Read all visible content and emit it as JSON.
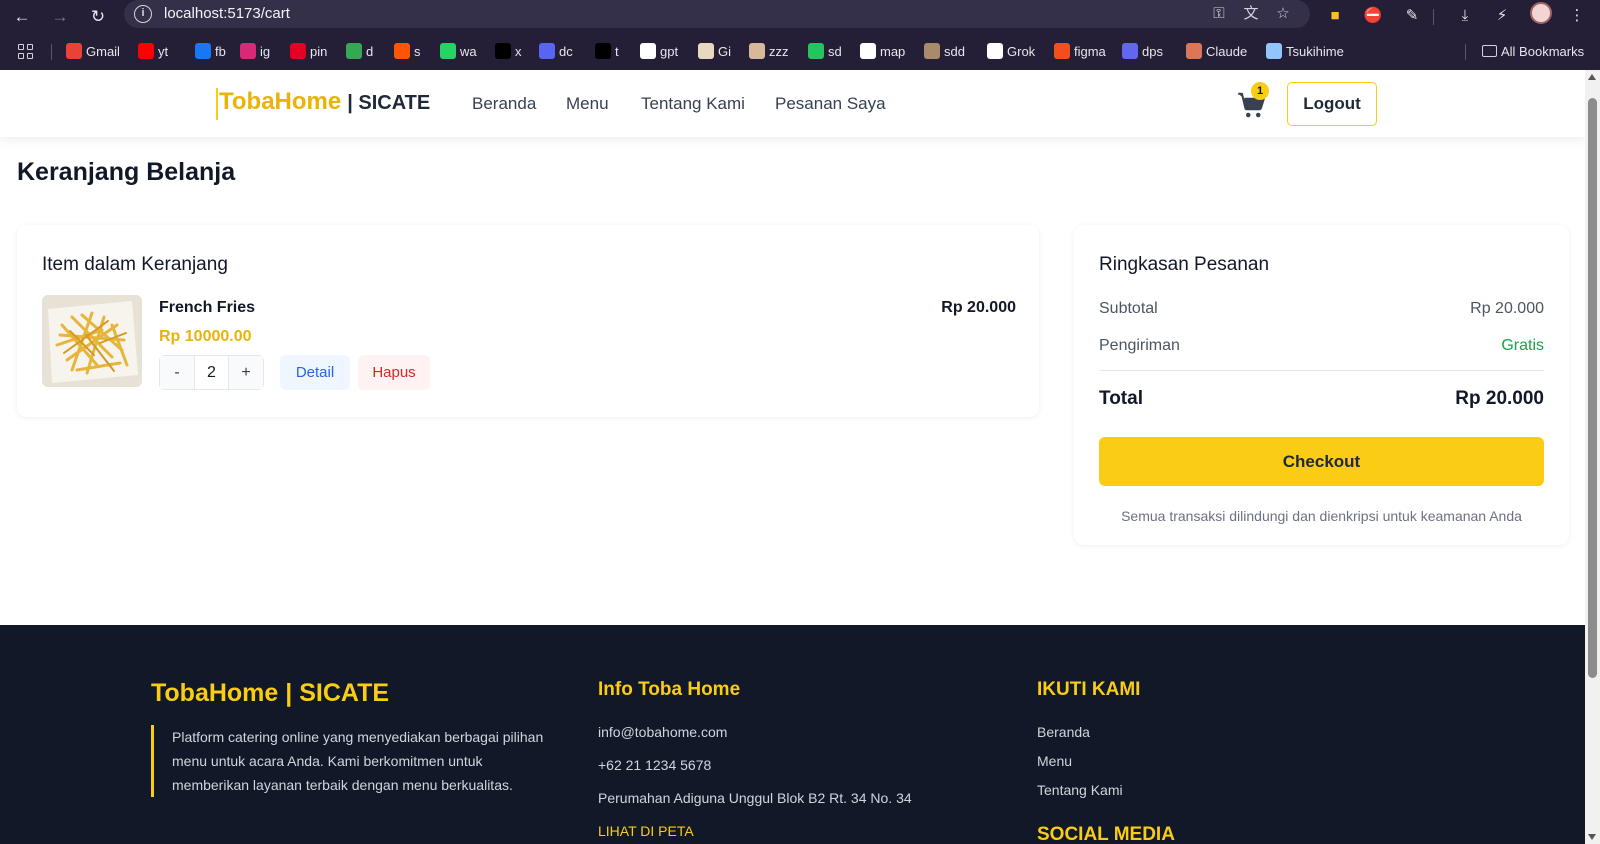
{
  "browser": {
    "url": "localhost:5173/cart",
    "bookmarks": [
      {
        "label": "Gmail",
        "color": "#ea4335"
      },
      {
        "label": "yt",
        "color": "#ff0000"
      },
      {
        "label": "fb",
        "color": "#1877f2"
      },
      {
        "label": "ig",
        "color": "#d62976"
      },
      {
        "label": "pin",
        "color": "#e60023"
      },
      {
        "label": "d",
        "color": "#34a853"
      },
      {
        "label": "s",
        "color": "#ff5500"
      },
      {
        "label": "wa",
        "color": "#25d366"
      },
      {
        "label": "x",
        "color": "#000000"
      },
      {
        "label": "dc",
        "color": "#5865f2"
      },
      {
        "label": "t",
        "color": "#000000"
      },
      {
        "label": "gpt",
        "color": "#ffffff"
      },
      {
        "label": "Gi",
        "color": "#e8d8c0"
      },
      {
        "label": "zzz",
        "color": "#d9b99b"
      },
      {
        "label": "sd",
        "color": "#22c55e"
      },
      {
        "label": "map",
        "color": "#ffffff"
      },
      {
        "label": "sdd",
        "color": "#a78b6b"
      },
      {
        "label": "Grok",
        "color": "#ffffff"
      },
      {
        "label": "figma",
        "color": "#f24e1e"
      },
      {
        "label": "dps",
        "color": "#6366f1"
      },
      {
        "label": "Claude",
        "color": "#d97757"
      },
      {
        "label": "Tsukihime",
        "color": "#93c5fd"
      }
    ],
    "all_bookmarks": "All Bookmarks"
  },
  "navbar": {
    "brand_main": "TobaHome",
    "brand_sub": "| SICATE",
    "links": [
      "Beranda",
      "Menu",
      "Tentang Kami",
      "Pesanan Saya"
    ],
    "cart_count": "1",
    "logout": "Logout"
  },
  "page": {
    "title": "Keranjang Belanja"
  },
  "cart": {
    "title": "Item dalam Keranjang",
    "items": [
      {
        "name": "French Fries",
        "unit_price": "Rp 10000.00",
        "line_total": "Rp 20.000",
        "quantity": "2",
        "minus": "-",
        "plus": "+",
        "detail": "Detail",
        "remove": "Hapus"
      }
    ]
  },
  "summary": {
    "title": "Ringkasan Pesanan",
    "subtotal_label": "Subtotal",
    "subtotal_value": "Rp 20.000",
    "shipping_label": "Pengiriman",
    "shipping_value": "Gratis",
    "total_label": "Total",
    "total_value": "Rp 20.000",
    "checkout": "Checkout",
    "secure_note": "Semua transaksi dilindungi dan dienkripsi untuk keamanan Anda"
  },
  "footer": {
    "brand": "TobaHome | SICATE",
    "description": "Platform catering online yang menyediakan berbagai pilihan menu untuk acara Anda. Kami berkomitmen untuk memberikan layanan terbaik dengan menu berkualitas.",
    "info_title": "Info Toba Home",
    "email": "info@tobahome.com",
    "phone": "+62 21 1234 5678",
    "address": "Perumahan Adiguna Unggul Blok B2 Rt. 34 No. 34",
    "map_link": "LIHAT DI PETA",
    "follow_title": "IKUTI KAMI",
    "follow_links": [
      "Beranda",
      "Menu",
      "Tentang Kami"
    ],
    "social_title": "SOCIAL MEDIA"
  },
  "colors": {
    "accent": "#facc15",
    "brand_text": "#eab308",
    "footer_bg": "#111827",
    "success": "#16a34a",
    "danger": "#dc2626",
    "info": "#2563eb"
  }
}
